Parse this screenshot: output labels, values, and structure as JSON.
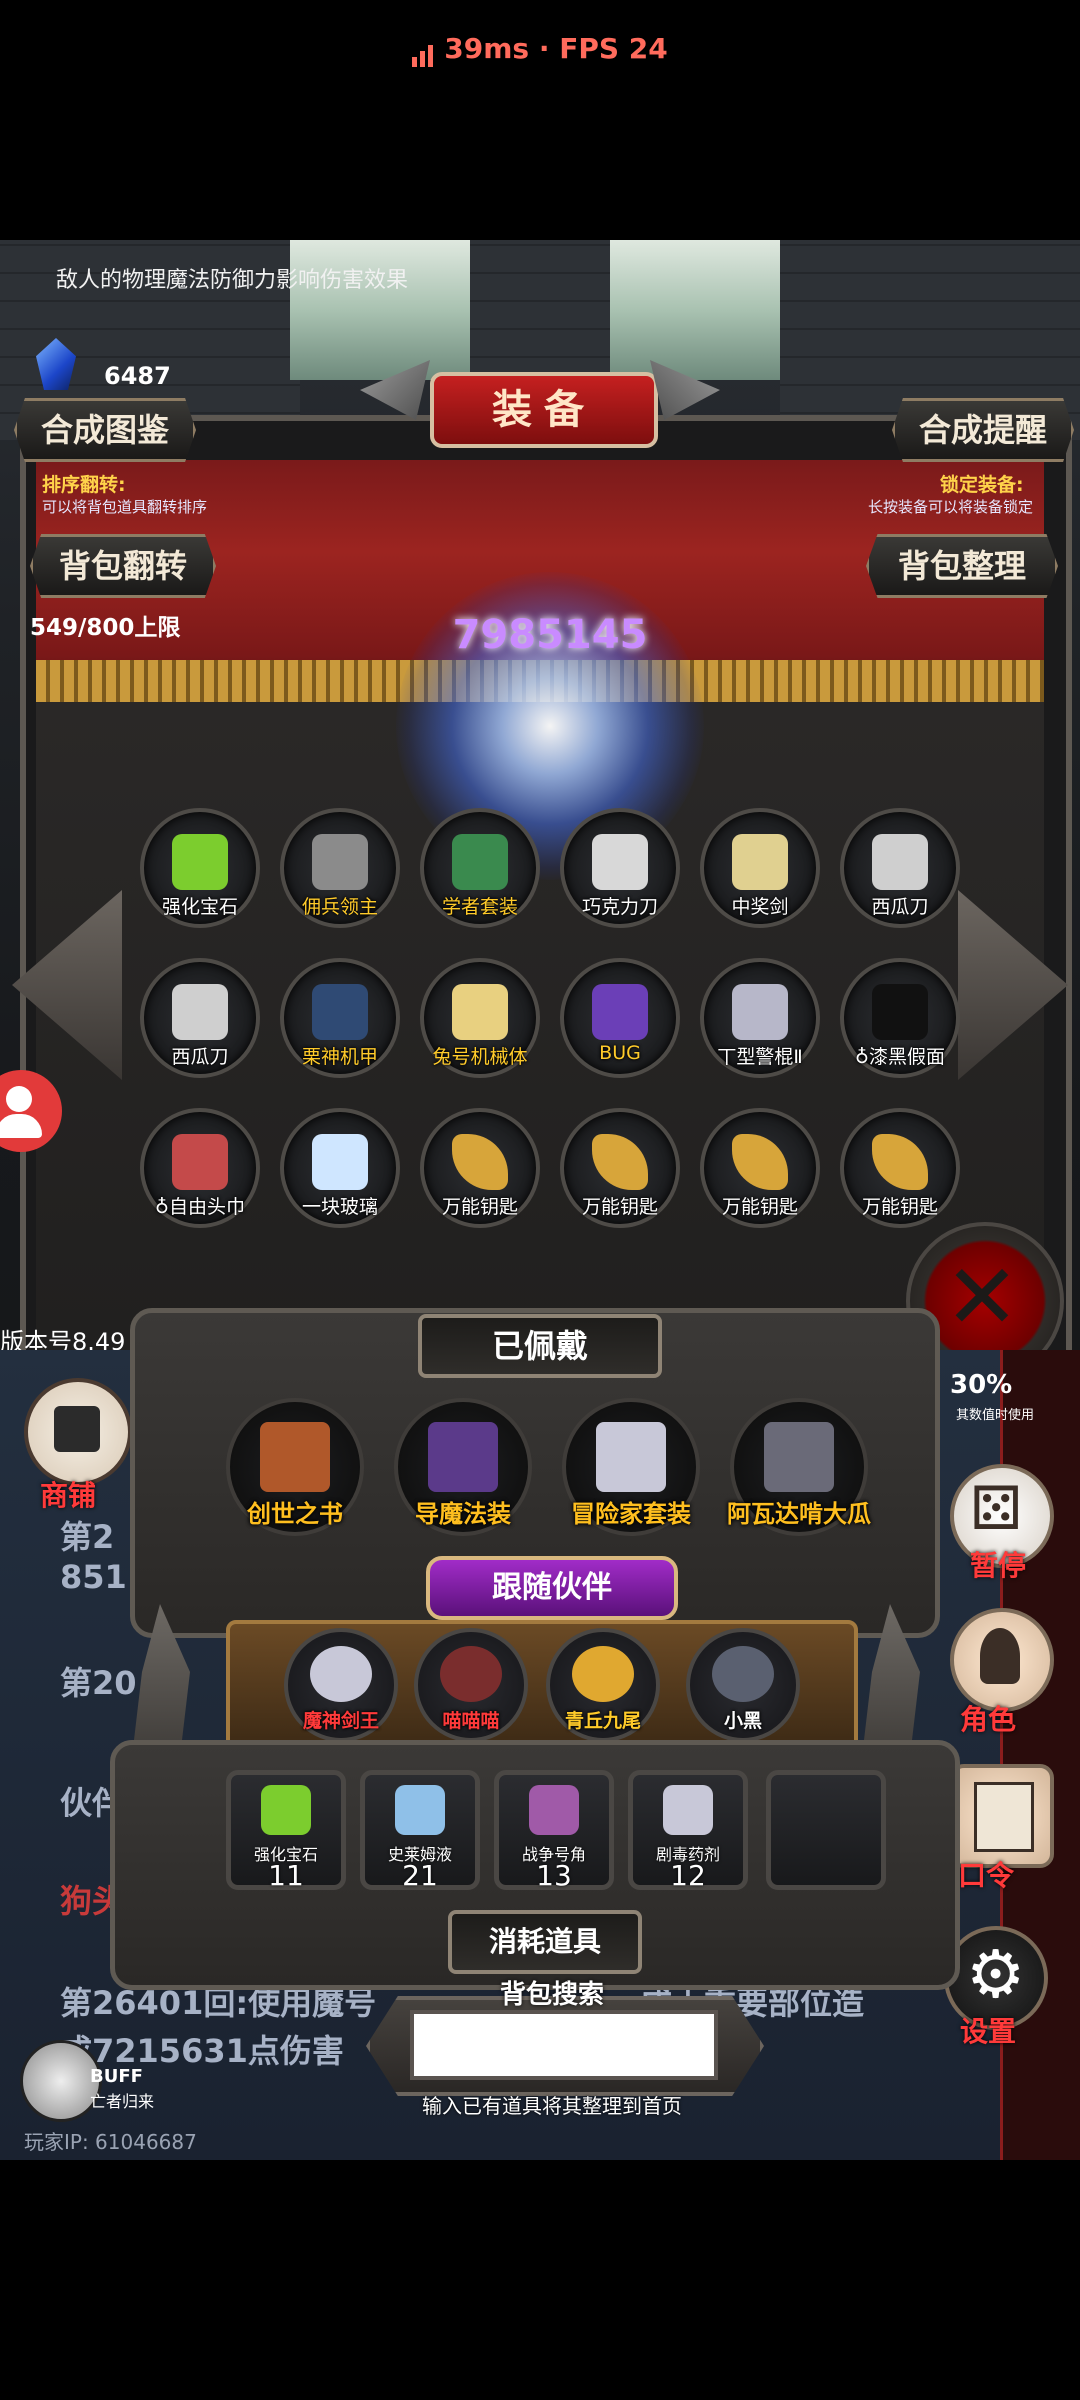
{
  "status": {
    "ping": "39ms",
    "separator": "·",
    "fps": "FPS 24"
  },
  "header": {
    "hint": "敌人的物理魔法防御力影响伤害效果",
    "gem_count": "6487",
    "title": "装备",
    "synth_book": "合成图鉴",
    "synth_remind": "合成提醒",
    "sort_flip_title": "排序翻转:",
    "sort_flip_desc": "可以将背包道具翻转排序",
    "lock_title": "锁定装备:",
    "lock_desc": "长按装备可以将装备锁定",
    "bag_flip": "背包翻转",
    "bag_sort": "背包整理",
    "capacity": "549/800上限",
    "orb_number": "7985145"
  },
  "inventory": [
    {
      "label": "强化宝石",
      "color": "white",
      "icon": "green-gem-icon"
    },
    {
      "label": "佣兵领主",
      "color": "gold",
      "icon": "armored-knight-icon"
    },
    {
      "label": "学者套装",
      "color": "gold",
      "icon": "scholar-armor-icon"
    },
    {
      "label": "巧克力刀",
      "color": "white",
      "icon": "chocolate-knife-icon"
    },
    {
      "label": "中奖剑",
      "color": "white",
      "icon": "prize-sword-icon"
    },
    {
      "label": "西瓜刀",
      "color": "white",
      "icon": "watermelon-knife-icon"
    },
    {
      "label": "西瓜刀",
      "color": "white",
      "icon": "watermelon-knife-icon"
    },
    {
      "label": "栗神机甲",
      "color": "gold",
      "icon": "mech-armor-icon"
    },
    {
      "label": "兔号机械体",
      "color": "gold",
      "icon": "rabbit-mech-icon"
    },
    {
      "label": "BUG",
      "color": "gold",
      "icon": "question-marks-icon"
    },
    {
      "label": "丅型警棍Ⅱ",
      "color": "white",
      "icon": "baton-icon"
    },
    {
      "label": "♁漆黑假面",
      "color": "white",
      "icon": "black-mask-icon"
    },
    {
      "label": "♁自由头巾",
      "color": "white",
      "icon": "bandana-icon"
    },
    {
      "label": "一块玻璃",
      "color": "white",
      "icon": "glass-shard-icon"
    },
    {
      "label": "万能钥匙",
      "color": "white",
      "icon": "master-key-icon"
    },
    {
      "label": "万能钥匙",
      "color": "white",
      "icon": "master-key-icon"
    },
    {
      "label": "万能钥匙",
      "color": "white",
      "icon": "master-key-icon"
    },
    {
      "label": "万能钥匙",
      "color": "white",
      "icon": "master-key-icon"
    }
  ],
  "version": "版本号8.49",
  "equipped": {
    "title": "已佩戴",
    "items": [
      {
        "label": "创世之书",
        "icon": "book-icon"
      },
      {
        "label": "导魔法装",
        "icon": "wizard-icon"
      },
      {
        "label": "冒险家套装",
        "icon": "adventurer-icon"
      },
      {
        "label": "阿瓦达啃大瓜",
        "icon": "staff-icon"
      }
    ]
  },
  "followers": {
    "title": "跟随伙伴",
    "items": [
      {
        "label": "魔神剑王",
        "color": "#ff3a3a"
      },
      {
        "label": "喵喵喵",
        "color": "#ff3a3a"
      },
      {
        "label": "青丘九尾",
        "color": "#ffcb2a"
      },
      {
        "label": "小黑",
        "color": "#ffffff"
      }
    ]
  },
  "consumables": {
    "title": "消耗道具",
    "items": [
      {
        "label": "强化宝石",
        "count": "11"
      },
      {
        "label": "史莱姆液",
        "count": "21"
      },
      {
        "label": "战争号角",
        "count": "13"
      },
      {
        "label": "剧毒药剂",
        "count": "12"
      }
    ]
  },
  "sidebar": {
    "shop": "商铺",
    "pause": "暂停",
    "role": "角色",
    "command": "口令",
    "settings": "设置",
    "stat_value": "30%",
    "stat_desc": "其数值时使用"
  },
  "logs": {
    "line1": "第2",
    "line1b": "851",
    "line2": "第20",
    "line3": "伙伴",
    "line4": "狗头",
    "line5": "第26401回:使用魔号",
    "line5b": "成士重要部位造",
    "line6": "成7215631点伤害"
  },
  "search": {
    "title": "背包搜索",
    "hint": "输入已有道具将其整理到首页",
    "value": ""
  },
  "footer": {
    "buff": "BUFF",
    "buff_sub": "亡者归来",
    "player_ip": "玩家IP: 61046687"
  }
}
